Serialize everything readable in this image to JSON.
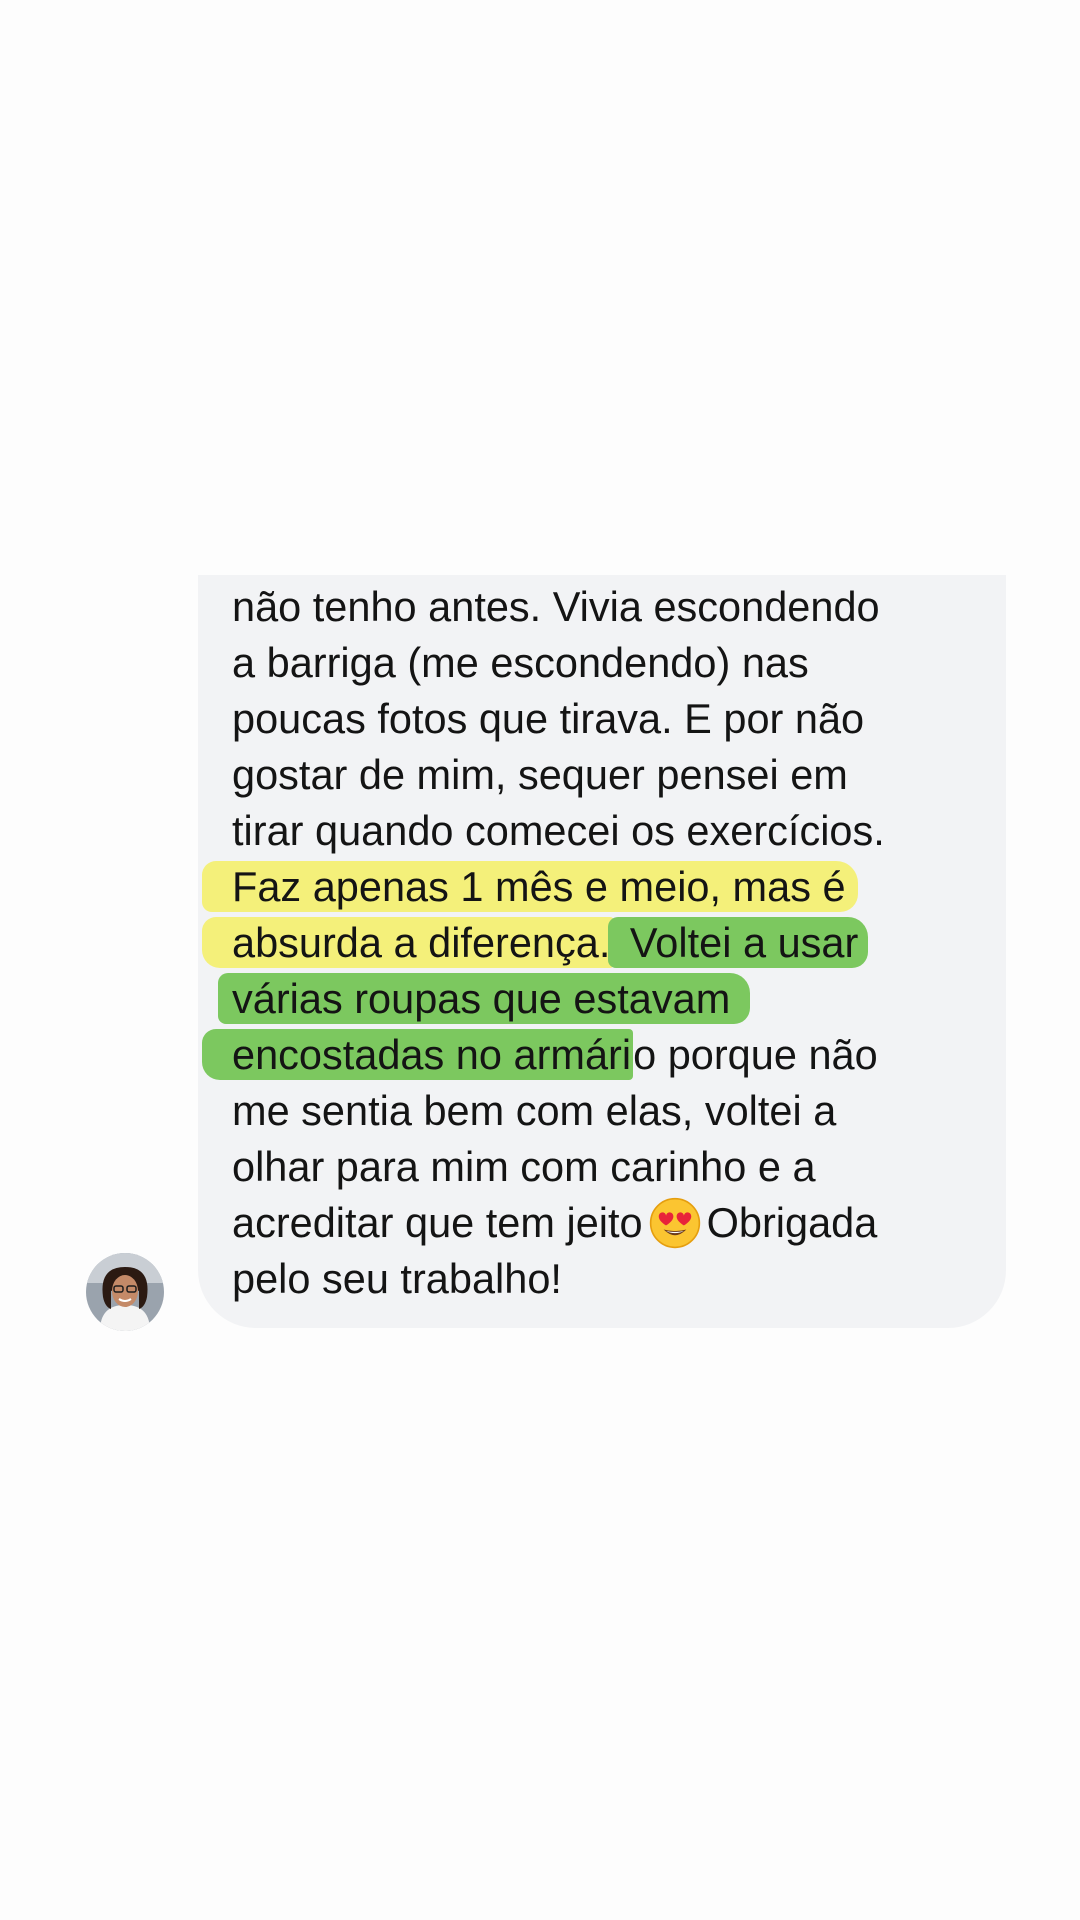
{
  "message": {
    "lines": [
      "não tenho antes. Vivia escondendo",
      "a barriga (me escondendo) nas",
      "poucas fotos que tirava. E por não",
      "gostar de mim, sequer pensei em",
      "tirar quando comecei os exercícios."
    ],
    "highlight_yellow_1": "Faz apenas 1 mês e meio, mas é",
    "highlight_yellow_2": "absurda a diferença.",
    "highlight_green_1": " Voltei a usar",
    "highlight_green_2": "várias roupas que estavam",
    "highlight_green_3": "encostadas no armári",
    "after_highlight": "o porque não",
    "tail_lines": [
      "me sentia bem com elas, voltei a",
      "olhar para mim com carinho e a"
    ],
    "before_emoji": "acreditar que tem jeito",
    "emoji_name": "heart-eyes-emoji-icon",
    "after_emoji": "Obrigada",
    "last_line": "pelo seu trabalho!"
  },
  "colors": {
    "bubble": "#f2f3f5",
    "text": "#141414",
    "highlight_yellow": "#f4f07a",
    "highlight_green": "#7cc85f"
  }
}
